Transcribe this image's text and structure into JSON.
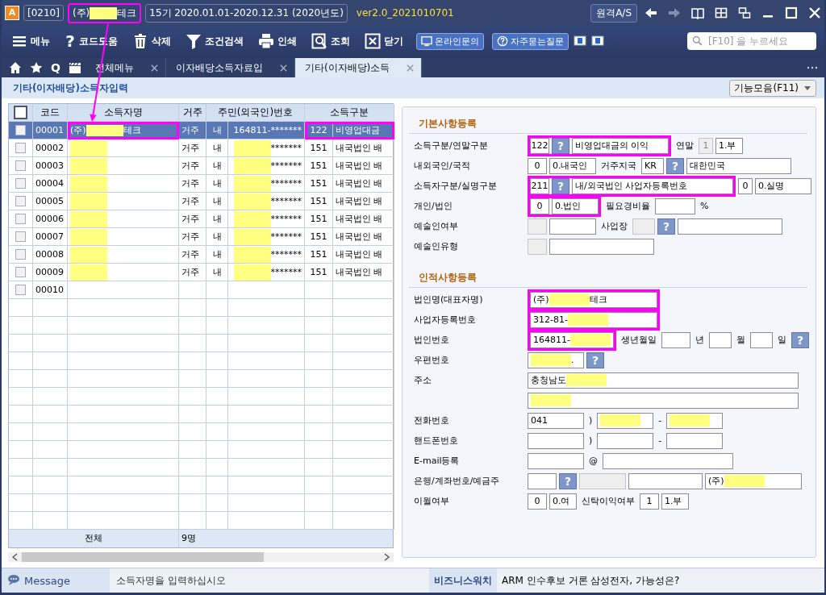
{
  "app": {
    "logo": "A",
    "code": "[0210]",
    "company": {
      "highlighted": true,
      "parts": [
        {
          "text": "(주)"
        },
        {
          "kind": "redaction"
        },
        {
          "text": "테크"
        }
      ]
    },
    "period": "15기 2020.01.01-2020.12.31 (2020년도)",
    "version": "ver2.0_2021010701",
    "remote_button": "원격A/S"
  },
  "toolbar": {
    "buttons": [
      {
        "label": "메뉴"
      },
      {
        "label": "코드도움",
        "glyph": "?"
      },
      {
        "label": "삭제"
      },
      {
        "label": "조건검색"
      },
      {
        "label": "인쇄"
      },
      {
        "label": "조회"
      },
      {
        "label": "닫기"
      }
    ],
    "links": [
      {
        "label": "온라인문의"
      },
      {
        "label": "자주묻는질문"
      }
    ],
    "search": {
      "placeholder": "[F10] 을 누르세요"
    }
  },
  "tab_glyph": "Q",
  "tabs": [
    {
      "label": "전체메뉴",
      "selected": false
    },
    {
      "label": "이자배당소득자료입",
      "selected": false
    },
    {
      "label": "기타(이자배당)소득",
      "selected": true
    }
  ],
  "page": {
    "title": "기타(이자배당)소득자입력",
    "function_menu": "기능모음(F11)"
  },
  "table": {
    "all_checked": false,
    "columns": [
      "코드",
      "소득자명",
      "거주",
      "주민(외국인)번호",
      "소득구분"
    ],
    "rows": [
      {
        "selected": true,
        "checked": false,
        "code": "00001",
        "name": {
          "highlighted": true,
          "parts": [
            {
              "text": "(주)"
            },
            {
              "kind": "redaction"
            },
            {
              "text": "테크"
            }
          ]
        },
        "residence": "거주",
        "nationality": "내",
        "id": {
          "parts": [
            {
              "text": "164811-*******"
            }
          ]
        },
        "income": {
          "highlighted": true,
          "code": "122",
          "name": "비영업대금"
        }
      },
      {
        "selected": false,
        "checked": false,
        "code": "00002",
        "name": {
          "highlighted": false,
          "parts": [
            {
              "kind": "redaction"
            }
          ]
        },
        "residence": "거주",
        "nationality": "내",
        "id": {
          "parts": [
            {
              "kind": "redaction"
            },
            {
              "text": "*******"
            }
          ]
        },
        "income": {
          "highlighted": false,
          "code": "151",
          "name": "내국법인 배"
        }
      },
      {
        "selected": false,
        "checked": false,
        "code": "00003",
        "name": {
          "highlighted": false,
          "parts": [
            {
              "kind": "redaction"
            }
          ]
        },
        "residence": "거주",
        "nationality": "내",
        "id": {
          "parts": [
            {
              "kind": "redaction"
            },
            {
              "text": "*******"
            }
          ]
        },
        "income": {
          "highlighted": false,
          "code": "151",
          "name": "내국법인 배"
        }
      },
      {
        "selected": false,
        "checked": false,
        "code": "00004",
        "name": {
          "highlighted": false,
          "parts": [
            {
              "kind": "redaction"
            }
          ]
        },
        "residence": "거주",
        "nationality": "내",
        "id": {
          "parts": [
            {
              "kind": "redaction"
            },
            {
              "text": "*******"
            }
          ]
        },
        "income": {
          "highlighted": false,
          "code": "151",
          "name": "내국법인 배"
        }
      },
      {
        "selected": false,
        "checked": false,
        "code": "00005",
        "name": {
          "highlighted": false,
          "parts": [
            {
              "kind": "redaction"
            }
          ]
        },
        "residence": "거주",
        "nationality": "내",
        "id": {
          "parts": [
            {
              "kind": "redaction"
            },
            {
              "text": "*******"
            }
          ]
        },
        "income": {
          "highlighted": false,
          "code": "151",
          "name": "내국법인 배"
        }
      },
      {
        "selected": false,
        "checked": false,
        "code": "00006",
        "name": {
          "highlighted": false,
          "parts": [
            {
              "kind": "redaction"
            }
          ]
        },
        "residence": "거주",
        "nationality": "내",
        "id": {
          "parts": [
            {
              "kind": "redaction"
            },
            {
              "text": "*******"
            }
          ]
        },
        "income": {
          "highlighted": false,
          "code": "151",
          "name": "내국법인 배"
        }
      },
      {
        "selected": false,
        "checked": false,
        "code": "00007",
        "name": {
          "highlighted": false,
          "parts": [
            {
              "kind": "redaction"
            }
          ]
        },
        "residence": "거주",
        "nationality": "내",
        "id": {
          "parts": [
            {
              "kind": "redaction"
            },
            {
              "text": "*******"
            }
          ]
        },
        "income": {
          "highlighted": false,
          "code": "151",
          "name": "내국법인 배"
        }
      },
      {
        "selected": false,
        "checked": false,
        "code": "00008",
        "name": {
          "highlighted": false,
          "parts": [
            {
              "kind": "redaction"
            }
          ]
        },
        "residence": "거주",
        "nationality": "내",
        "id": {
          "parts": [
            {
              "kind": "redaction"
            },
            {
              "text": "*******"
            }
          ]
        },
        "income": {
          "highlighted": false,
          "code": "151",
          "name": "내국법인 배"
        }
      },
      {
        "selected": false,
        "checked": false,
        "code": "00009",
        "name": {
          "highlighted": false,
          "parts": [
            {
              "kind": "redaction"
            }
          ]
        },
        "residence": "거주",
        "nationality": "내",
        "id": {
          "parts": [
            {
              "kind": "redaction"
            },
            {
              "text": "*******"
            }
          ]
        },
        "income": {
          "highlighted": false,
          "code": "151",
          "name": "내국법인 배"
        }
      },
      {
        "selected": false,
        "checked": false,
        "code": "00010"
      }
    ],
    "footer": {
      "label": "전체",
      "count": "9명"
    }
  },
  "form": {
    "sections": [
      {
        "title": "기본사항등록",
        "rows": [
          {
            "label": "소득구분/연말구분",
            "items": [
              {
                "kind": "highlight",
                "items": [
                  {
                    "kind": "code",
                    "value": "122",
                    "disabled": false
                  },
                  {
                    "kind": "help",
                    "label": "?"
                  },
                  {
                    "kind": "wide",
                    "value": "비영업대금의 이익",
                    "disabled": false
                  }
                ]
              },
              {
                "kind": "text",
                "text": "연말"
              },
              {
                "kind": "flag",
                "value": "1",
                "disabled": true
              },
              {
                "kind": "tag",
                "value": "1.부",
                "disabled": false
              }
            ]
          },
          {
            "label": "내외국인/국적",
            "items": [
              {
                "kind": "code",
                "value": "0",
                "disabled": false
              },
              {
                "kind": "label",
                "value": "0.내국인",
                "disabled": false
              },
              {
                "kind": "text",
                "text": "거주지국"
              },
              {
                "kind": "narrow",
                "value": "KR",
                "disabled": false
              },
              {
                "kind": "help",
                "label": "?"
              },
              {
                "kind": "extra",
                "value": "대한민국",
                "disabled": false
              }
            ]
          },
          {
            "label": "소득자구분/실명구분",
            "items": [
              {
                "kind": "highlight",
                "items": [
                  {
                    "kind": "code",
                    "value": "211",
                    "disabled": false
                  },
                  {
                    "kind": "help",
                    "label": "?"
                  },
                  {
                    "kind": "long",
                    "value": "내/외국법인 사업자등록번호",
                    "disabled": false
                  }
                ]
              },
              {
                "kind": "flag",
                "value": "0",
                "disabled": false
              },
              {
                "kind": "box",
                "value": "0.실명",
                "disabled": false
              }
            ]
          },
          {
            "label": "개인/법인",
            "items": [
              {
                "kind": "highlight",
                "items": [
                  {
                    "kind": "code",
                    "value": "0",
                    "disabled": false
                  },
                  {
                    "kind": "label",
                    "value": "0.법인",
                    "disabled": false
                  }
                ]
              },
              {
                "kind": "text",
                "text": "필요경비율"
              },
              {
                "kind": "mid",
                "disabled": false
              },
              {
                "kind": "text",
                "text": "%"
              }
            ]
          },
          {
            "label": "예술인여부",
            "items": [
              {
                "kind": "code",
                "disabled": true
              },
              {
                "kind": "label",
                "disabled": false
              },
              {
                "kind": "text",
                "text": "사업장"
              },
              {
                "kind": "narrow",
                "disabled": true
              },
              {
                "kind": "help",
                "label": "?"
              },
              {
                "kind": "extra",
                "disabled": false
              }
            ]
          },
          {
            "label": "예술인유형",
            "items": [
              {
                "kind": "code",
                "disabled": true
              },
              {
                "kind": "extra",
                "disabled": false
              }
            ]
          }
        ]
      },
      {
        "title": "인적사항등록",
        "rows": [
          {
            "label": "법인명(대표자명)",
            "items": [
              {
                "kind": "highlight",
                "items": [
                  {
                    "kind": "name",
                    "parts": [
                      {
                        "text": "(주)"
                      },
                      {
                        "kind": "redaction"
                      },
                      {
                        "text": "테크"
                      }
                    ],
                    "disabled": false
                  }
                ]
              }
            ]
          },
          {
            "label": "사업자등록번호",
            "items": [
              {
                "kind": "highlight",
                "items": [
                  {
                    "kind": "name",
                    "parts": [
                      {
                        "text": "312-81-"
                      },
                      {
                        "kind": "redaction"
                      }
                    ],
                    "disabled": false
                  }
                ]
              }
            ]
          },
          {
            "label": "법인번호",
            "items": [
              {
                "kind": "highlight",
                "items": [
                  {
                    "kind": "num",
                    "parts": [
                      {
                        "text": "164811-"
                      },
                      {
                        "kind": "redaction"
                      }
                    ],
                    "disabled": false
                  }
                ]
              },
              {
                "kind": "text",
                "text": "생년월일"
              },
              {
                "kind": "short",
                "disabled": false
              },
              {
                "kind": "text",
                "text": "년"
              },
              {
                "kind": "narrow",
                "disabled": false
              },
              {
                "kind": "text",
                "text": "월"
              },
              {
                "kind": "narrow",
                "disabled": false
              },
              {
                "kind": "text",
                "text": "일"
              },
              {
                "kind": "help",
                "label": "?"
              }
            ]
          },
          {
            "label": "우편번호",
            "items": [
              {
                "kind": "box",
                "parts": [
                  {
                    "kind": "redaction"
                  },
                  {
                    "text": "."
                  }
                ],
                "disabled": false
              },
              {
                "kind": "help",
                "label": "?"
              }
            ]
          },
          {
            "label": "주소",
            "items": [
              {
                "kind": "full",
                "parts": [
                  {
                    "text": "충청남도"
                  },
                  {
                    "kind": "redaction"
                  }
                ],
                "disabled": false
              }
            ]
          },
          {
            "items": [
              {
                "kind": "full",
                "parts": [
                  {
                    "kind": "redaction"
                  }
                ],
                "disabled": false
              }
            ]
          },
          {
            "label": "전화번호",
            "items": [
              {
                "kind": "box",
                "value": "041",
                "disabled": false
              },
              {
                "kind": "text",
                "text": ")"
              },
              {
                "kind": "box",
                "parts": [
                  {
                    "kind": "redaction"
                  }
                ],
                "disabled": false
              },
              {
                "kind": "text",
                "text": "-"
              },
              {
                "kind": "box",
                "parts": [
                  {
                    "kind": "redaction"
                  }
                ],
                "disabled": false
              }
            ]
          },
          {
            "label": "핸드폰번호",
            "items": [
              {
                "kind": "box",
                "disabled": false
              },
              {
                "kind": "text",
                "text": ")"
              },
              {
                "kind": "box",
                "disabled": false
              },
              {
                "kind": "text",
                "text": "-"
              },
              {
                "kind": "box",
                "disabled": false
              }
            ]
          },
          {
            "label": "E-mail등록",
            "items": [
              {
                "kind": "box",
                "disabled": false
              },
              {
                "kind": "text",
                "text": "@"
              },
              {
                "kind": "email",
                "disabled": false
              }
            ]
          },
          {
            "label": "은행/계좌번호/예금주",
            "items": [
              {
                "kind": "short",
                "disabled": false
              },
              {
                "kind": "help",
                "label": "?"
              },
              {
                "kind": "label",
                "disabled": true
              },
              {
                "kind": "ref",
                "disabled": false
              },
              {
                "kind": "wide",
                "parts": [
                  {
                    "text": "(주)"
                  },
                  {
                    "kind": "redaction"
                  }
                ],
                "disabled": false
              }
            ]
          },
          {
            "label": "이월여부",
            "items": [
              {
                "kind": "code",
                "value": "0",
                "disabled": false
              },
              {
                "kind": "tag",
                "value": "0.여",
                "disabled": false
              },
              {
                "kind": "text",
                "text": "신탁이익여부"
              },
              {
                "kind": "code",
                "value": "1",
                "disabled": false
              },
              {
                "kind": "tag",
                "value": "1.부",
                "disabled": false
              }
            ]
          }
        ]
      }
    ]
  },
  "status_bar": {
    "message_label": "Message",
    "message": "소득자명을 입력하십시오",
    "news_label": "비즈니스워치",
    "news": "ARM 인수후보 거론 삼성전자, 가능성은?"
  }
}
